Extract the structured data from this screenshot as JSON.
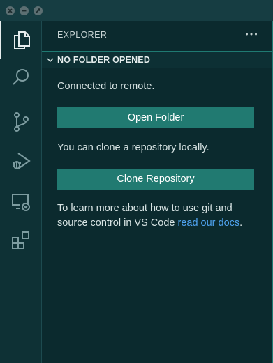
{
  "window": {
    "controls": [
      "close-icon",
      "minimize-icon",
      "zoom-icon"
    ]
  },
  "activity_bar": {
    "items": [
      {
        "name": "explorer",
        "icon": "files-icon",
        "active": true
      },
      {
        "name": "search",
        "icon": "search-icon",
        "active": false
      },
      {
        "name": "source-control",
        "icon": "source-control-icon",
        "active": false
      },
      {
        "name": "run-and-debug",
        "icon": "run-debug-icon",
        "active": false
      },
      {
        "name": "remote-explorer",
        "icon": "remote-explorer-icon",
        "active": false
      },
      {
        "name": "extensions",
        "icon": "extensions-icon",
        "active": false
      }
    ]
  },
  "sidebar": {
    "title": "EXPLORER",
    "more_icon": "ellipsis-icon",
    "section": {
      "title": "NO FOLDER OPENED",
      "expanded": true
    },
    "welcome": {
      "connected_text": "Connected to remote.",
      "open_folder_label": "Open Folder",
      "clone_text": "You can clone a repository locally.",
      "clone_label": "Clone Repository",
      "learn_text": "To learn more about how to use git and source control in VS Code ",
      "learn_link": "read our docs",
      "learn_end": "."
    }
  },
  "colors": {
    "background": "#0b2a2e",
    "activity_bar": "#0e3135",
    "button": "#217a71",
    "link": "#4fa3f0",
    "border_accent": "#1f7a72"
  }
}
